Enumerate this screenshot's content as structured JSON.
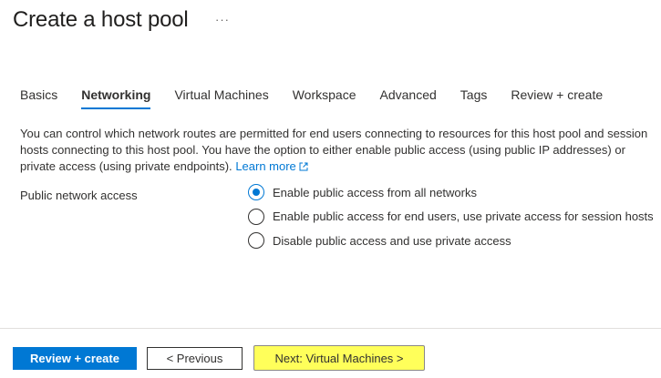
{
  "header": {
    "title": "Create a host pool",
    "more_label": "···"
  },
  "tabs": [
    {
      "label": "Basics",
      "active": false
    },
    {
      "label": "Networking",
      "active": true
    },
    {
      "label": "Virtual Machines",
      "active": false
    },
    {
      "label": "Workspace",
      "active": false
    },
    {
      "label": "Advanced",
      "active": false
    },
    {
      "label": "Tags",
      "active": false
    },
    {
      "label": "Review + create",
      "active": false
    }
  ],
  "description": {
    "text": "You can control which network routes are permitted for end users connecting to resources for this host pool and session hosts connecting to this host pool. You have the option to either enable public access (using public IP addresses) or private access (using private endpoints).",
    "learn_more": "Learn more"
  },
  "public_network_access": {
    "label": "Public network access",
    "options": [
      {
        "label": "Enable public access from all networks",
        "selected": true
      },
      {
        "label": "Enable public access for end users, use private access for session hosts",
        "selected": false
      },
      {
        "label": "Disable public access and use private access",
        "selected": false
      }
    ]
  },
  "footer": {
    "review_create": "Review + create",
    "previous": "< Previous",
    "next": "Next: Virtual Machines >"
  },
  "colors": {
    "accent": "#0078d4",
    "highlight": "#ffff5a"
  }
}
